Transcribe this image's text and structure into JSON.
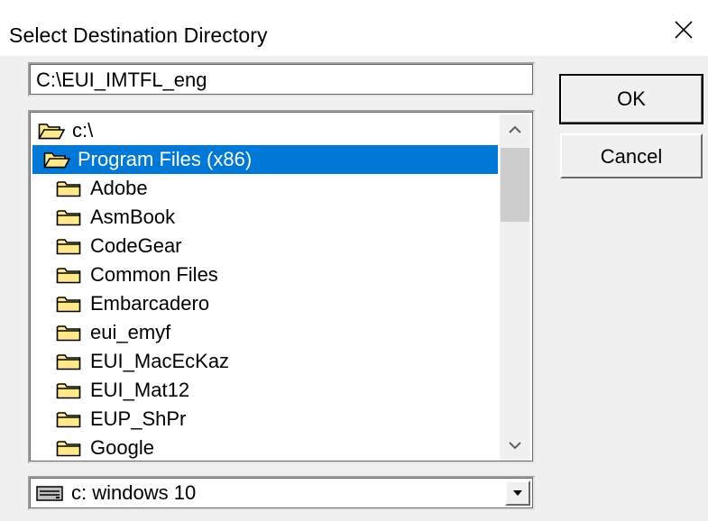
{
  "window": {
    "title": "Select Destination Directory"
  },
  "path_input": {
    "value": "C:\\EUI_IMTFL_eng"
  },
  "buttons": {
    "ok": "OK",
    "cancel": "Cancel"
  },
  "folders": [
    {
      "label": "c:\\",
      "icon": "open-folder-icon",
      "indent": 0,
      "selected": false
    },
    {
      "label": "Program Files (x86)",
      "icon": "open-folder-icon",
      "indent": 1,
      "selected": true
    },
    {
      "label": "Adobe",
      "icon": "folder-icon",
      "indent": 2,
      "selected": false
    },
    {
      "label": "AsmBook",
      "icon": "folder-icon",
      "indent": 2,
      "selected": false
    },
    {
      "label": "CodeGear",
      "icon": "folder-icon",
      "indent": 2,
      "selected": false
    },
    {
      "label": "Common Files",
      "icon": "folder-icon",
      "indent": 2,
      "selected": false
    },
    {
      "label": "Embarcadero",
      "icon": "folder-icon",
      "indent": 2,
      "selected": false
    },
    {
      "label": "eui_emyf",
      "icon": "folder-icon",
      "indent": 2,
      "selected": false
    },
    {
      "label": "EUI_MacEcKaz",
      "icon": "folder-icon",
      "indent": 2,
      "selected": false
    },
    {
      "label": "EUI_Mat12",
      "icon": "folder-icon",
      "indent": 2,
      "selected": false
    },
    {
      "label": "EUP_ShPr",
      "icon": "folder-icon",
      "indent": 2,
      "selected": false
    },
    {
      "label": "Google",
      "icon": "folder-icon",
      "indent": 2,
      "selected": false
    }
  ],
  "drive": {
    "label": "c:  windows 10",
    "icon": "hard-drive-icon"
  },
  "colors": {
    "selection": "#0078d7",
    "folder_fill": "#ffe98a",
    "folder_stroke": "#000000"
  }
}
